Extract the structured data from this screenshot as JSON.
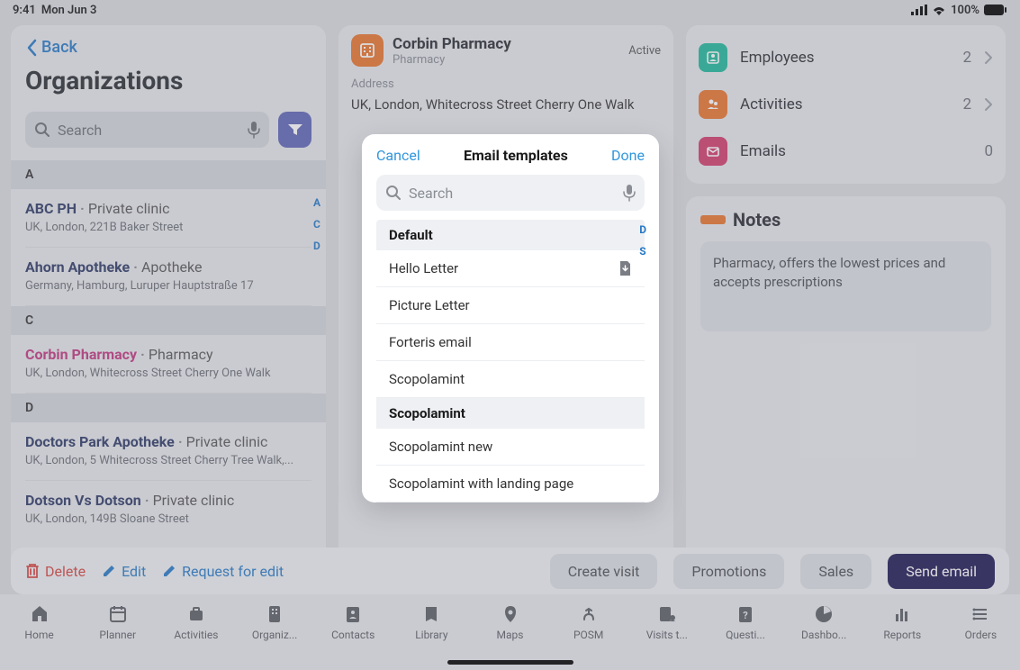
{
  "status": {
    "time": "9:41",
    "day": "Mon Jun 3",
    "battery": "100%"
  },
  "left": {
    "back": "Back",
    "title": "Organizations",
    "search_placeholder": "Search",
    "alpha": [
      "A",
      "C",
      "D"
    ],
    "sections": [
      {
        "letter": "A",
        "items": [
          {
            "name": "ABC PH",
            "type": "Private clinic",
            "addr": "UK, London, 221B Baker Street",
            "selected": false
          },
          {
            "name": "Ahorn Apotheke",
            "type": "Apotheke",
            "addr": "Germany, Hamburg, Luruper Hauptstraße 17",
            "selected": false
          }
        ]
      },
      {
        "letter": "C",
        "items": [
          {
            "name": "Corbin Pharmacy",
            "type": "Pharmacy",
            "addr": "UK, London, Whitecross Street Cherry One Walk",
            "selected": true
          }
        ]
      },
      {
        "letter": "D",
        "items": [
          {
            "name": "Doctors Park Apotheke",
            "type": "Private clinic",
            "addr": "UK, London, 5 Whitecross Street Cherry Tree Walk,...",
            "selected": false
          },
          {
            "name": "Dotson Vs Dotson",
            "type": "Private clinic",
            "addr": "UK, London, 149B Sloane Street",
            "selected": false
          }
        ]
      }
    ]
  },
  "middle": {
    "name": "Corbin Pharmacy",
    "sub": "Pharmacy",
    "status": "Active",
    "address_label": "Address",
    "address": "UK, London, Whitecross Street Cherry One Walk"
  },
  "right": {
    "stats": [
      {
        "label": "Employees",
        "count": "2",
        "color": "teal"
      },
      {
        "label": "Activities",
        "count": "2",
        "color": "orange"
      },
      {
        "label": "Emails",
        "count": "0",
        "color": "pink"
      }
    ],
    "notes_title": "Notes",
    "notes_body": "Pharmacy, offers the lowest prices and accepts prescriptions"
  },
  "actions": {
    "delete": "Delete",
    "edit": "Edit",
    "request": "Request for edit",
    "create_visit": "Create visit",
    "promotions": "Promotions",
    "sales": "Sales",
    "send_email": "Send email"
  },
  "nav": [
    "Home",
    "Planner",
    "Activities",
    "Organiz...",
    "Contacts",
    "Library",
    "Maps",
    "POSM",
    "Visits t...",
    "Questi...",
    "Dashbo...",
    "Reports",
    "Orders"
  ],
  "modal": {
    "cancel": "Cancel",
    "title": "Email templates",
    "done": "Done",
    "search_placeholder": "Search",
    "index": [
      "D",
      "S"
    ],
    "groups": [
      {
        "name": "Default",
        "items": [
          {
            "label": "Hello Letter",
            "download": true
          },
          {
            "label": "Picture Letter",
            "download": false
          },
          {
            "label": "Forteris email",
            "download": false
          },
          {
            "label": "Scopolamint",
            "download": false
          }
        ]
      },
      {
        "name": "Scopolamint",
        "items": [
          {
            "label": "Scopolamint new",
            "download": false
          },
          {
            "label": "Scopolamint with landing page",
            "download": false
          }
        ]
      }
    ]
  }
}
